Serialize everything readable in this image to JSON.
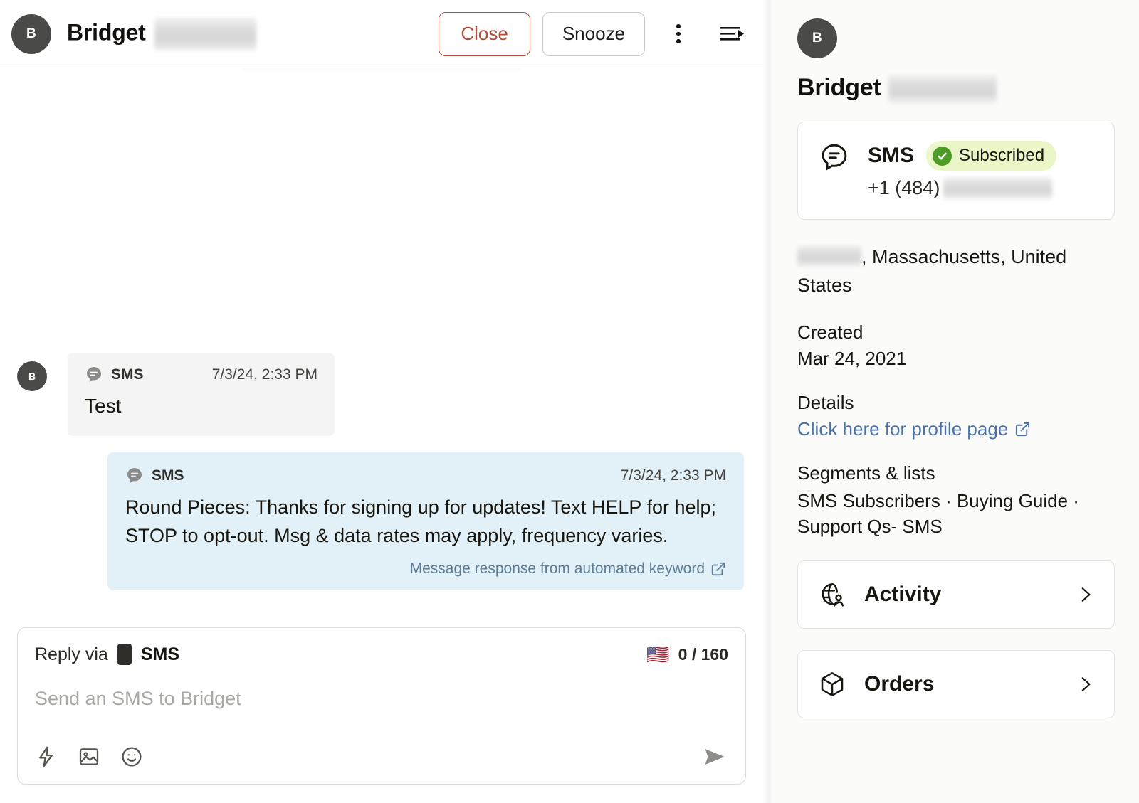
{
  "conversation": {
    "avatar_initial": "B",
    "title": "Bridget",
    "title_redacted": true,
    "actions": {
      "close_label": "Close",
      "snooze_label": "Snooze",
      "more_icon": "kebab-menu-icon",
      "collapse_icon": "collapse-panel-icon"
    },
    "messages": [
      {
        "direction": "incoming",
        "avatar_initial": "B",
        "channel": "SMS",
        "channel_icon": "sms-bubble-icon",
        "timestamp": "7/3/24, 2:33 PM",
        "body": "Test"
      },
      {
        "direction": "outgoing",
        "channel": "SMS",
        "channel_icon": "sms-bubble-icon",
        "timestamp": "7/3/24, 2:33 PM",
        "body": "Round Pieces: Thanks for signing up for updates! Text HELP for help; STOP to opt-out. Msg & data rates may apply, frequency varies.",
        "footer_link": "Message response from automated keyword",
        "footer_icon": "external-link-icon"
      }
    ],
    "composer": {
      "reply_via_label": "Reply via",
      "channel_label": "SMS",
      "channel_icon": "mobile-device-icon",
      "flag_icon": "🇺🇸",
      "counter": "0 / 160",
      "placeholder": "Send an SMS to Bridget",
      "tools": [
        {
          "icon": "lightning-bolt-icon"
        },
        {
          "icon": "image-icon"
        },
        {
          "icon": "emoji-smiley-icon"
        }
      ],
      "send_icon": "send-arrow-icon"
    }
  },
  "profile": {
    "avatar_initial": "B",
    "name": "Bridget",
    "name_redacted": true,
    "channel": {
      "icon": "sms-bubble-outline-icon",
      "name": "SMS",
      "status_label": "Subscribed",
      "status_icon": "check-circle-icon",
      "status_color": "#4d9c26",
      "status_bg": "#eaf5c8",
      "phone_prefix": "+1 (484)",
      "phone_redacted": true
    },
    "location": ", Massachusetts, United States",
    "location_redacted": true,
    "created_label": "Created",
    "created_value": "Mar 24, 2021",
    "details_label": "Details",
    "details_link": "Click here for profile page",
    "details_link_icon": "external-link-icon",
    "segments_label": "Segments & lists",
    "segments_value": "SMS Subscribers · Buying Guide · Support Qs- SMS",
    "nav": [
      {
        "label": "Activity",
        "icon": "activity-globe-person-icon"
      },
      {
        "label": "Orders",
        "icon": "package-box-icon"
      }
    ]
  }
}
